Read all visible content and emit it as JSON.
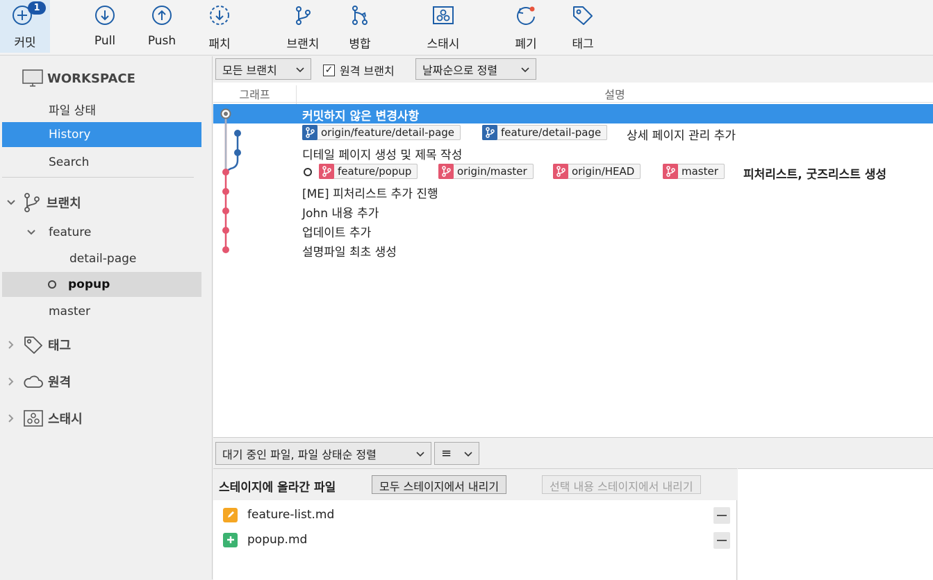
{
  "toolbar": {
    "commit": {
      "label": "커밋",
      "badge": "1"
    },
    "pull": {
      "label": "Pull"
    },
    "push": {
      "label": "Push"
    },
    "patch": {
      "label": "패치"
    },
    "branch": {
      "label": "브랜치"
    },
    "merge": {
      "label": "병합"
    },
    "stash": {
      "label": "스태시"
    },
    "discard": {
      "label": "폐기"
    },
    "tag": {
      "label": "태그"
    }
  },
  "sidebar": {
    "workspace": "WORKSPACE",
    "file_status": "파일 상태",
    "history": "History",
    "search": "Search",
    "branches": "브랜치",
    "feature": "feature",
    "detail_page": "detail-page",
    "popup": "popup",
    "master": "master",
    "tags": "태그",
    "remotes": "원격",
    "stashes": "스태시"
  },
  "filters": {
    "branch_filter": "모든 브랜치",
    "remote_branches": "원격 브랜치",
    "remote_checked": true,
    "sort": "날짜순으로 정렬"
  },
  "columns": {
    "graph": "그래프",
    "description": "설명"
  },
  "commits": [
    {
      "desc": "커밋하지 않은 변경사항",
      "tags": []
    },
    {
      "desc": "상세 페이지 관리 추가",
      "tags": [
        "origin/feature/detail-page",
        "feature/detail-page"
      ]
    },
    {
      "desc": "디테일 페이지 생성 및 제목 작성",
      "tags": []
    },
    {
      "desc": "피처리스트, 굿즈리스트 생성",
      "tags": [
        "feature/popup",
        "origin/master",
        "origin/HEAD",
        "master"
      ]
    },
    {
      "desc": "[ME] 피처리스트 추가 진행",
      "tags": []
    },
    {
      "desc": "John 내용 추가",
      "tags": []
    },
    {
      "desc": "업데이트 추가",
      "tags": []
    },
    {
      "desc": "설명파일 최초 생성",
      "tags": []
    }
  ],
  "bottom": {
    "file_sort": "대기 중인 파일, 파일 상태순 정렬",
    "view_mode": "≡",
    "staged_title": "스테이지에 올라간 파일",
    "unstage_all": "모두 스테이지에서 내리기",
    "unstage_selected": "선택 내용 스테이지에서 내리기",
    "files": [
      {
        "name": "feature-list.md",
        "status": "modified"
      },
      {
        "name": "popup.md",
        "status": "added"
      }
    ]
  },
  "colors": {
    "accent": "#3591e6",
    "branch_blue": "#2f68ad",
    "branch_red": "#e4566f",
    "modified": "#f5a623",
    "added": "#3cb371"
  }
}
